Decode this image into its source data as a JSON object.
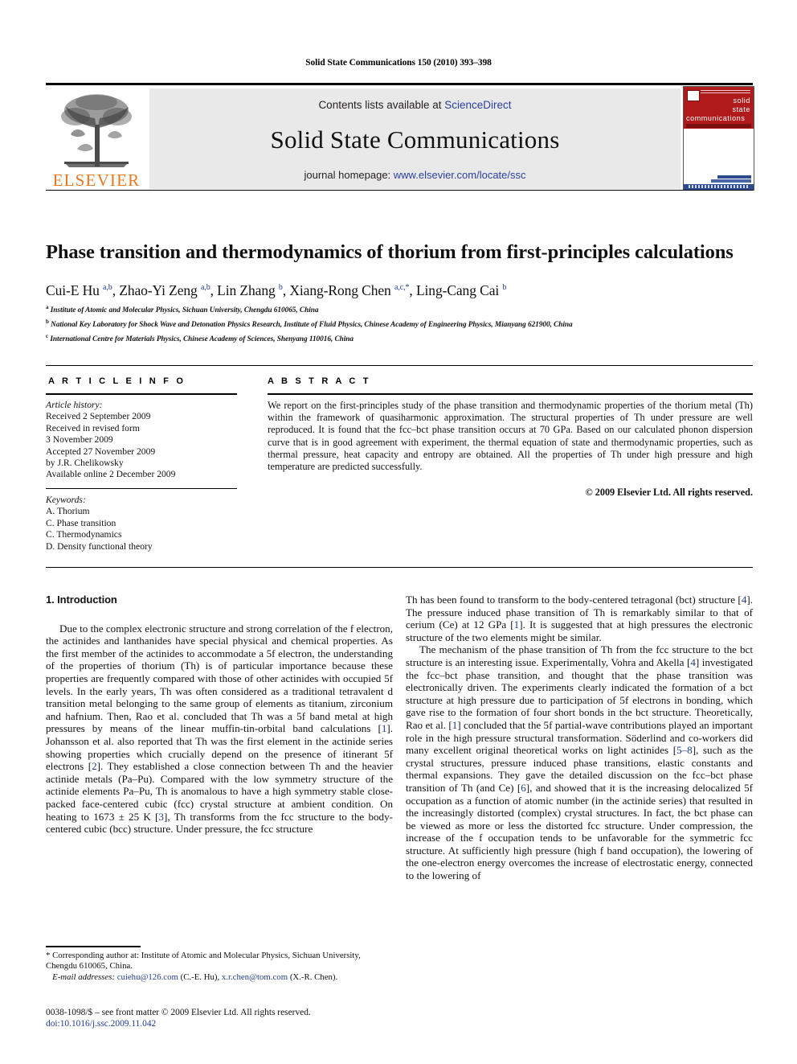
{
  "running_head": "Solid State Communications 150 (2010) 393–398",
  "masthead": {
    "contents_prefix": "Contents lists available at ",
    "sciencedirect": "ScienceDirect",
    "journal_title": "Solid State Communications",
    "homepage_prefix": "journal homepage: ",
    "homepage_url": "www.elsevier.com/locate/ssc",
    "publisher": "ELSEVIER",
    "cover": {
      "line1": "solid",
      "line2": "state",
      "line3": "communications"
    },
    "link_color": "#2b3f9e",
    "elsevier_orange": "#E87722",
    "band_gray": "#e9e9e9",
    "cover_red": "#b01a1a"
  },
  "article": {
    "title": "Phase transition and thermodynamics of thorium from first-principles calculations",
    "authors_html": "Cui-E Hu <sup>a,b</sup>, Zhao-Yi Zeng <sup>a,b</sup>, Lin Zhang <sup>b</sup>, Xiang-Rong Chen <sup>a,c,</sup><sup>*</sup>, Ling-Cang Cai <sup>b</sup>",
    "affiliations": [
      {
        "marker": "a",
        "text": "Institute of Atomic and Molecular Physics, Sichuan University, Chengdu 610065, China"
      },
      {
        "marker": "b",
        "text": "National Key Laboratory for Shock Wave and Detonation Physics Research, Institute of Fluid Physics, Chinese Academy of Engineering Physics, Mianyang 621900, China"
      },
      {
        "marker": "c",
        "text": "International Centre for Materials Physics, Chinese Academy of Sciences, Shenyang 110016, China"
      }
    ]
  },
  "info": {
    "heading": "A R T I C L E   I N F O",
    "history_label": "Article history:",
    "history_lines": [
      "Received 2 September 2009",
      "Received in revised form",
      "3 November 2009",
      "Accepted 27 November 2009",
      "by J.R. Chelikowsky",
      "Available online 2 December 2009"
    ],
    "keywords_label": "Keywords:",
    "keywords": [
      "A. Thorium",
      "C. Phase transition",
      "C. Thermodynamics",
      "D. Density functional theory"
    ]
  },
  "abstract": {
    "heading": "A B S T R A C T",
    "text": "We report on the first-principles study of the phase transition and thermodynamic properties of the thorium metal (Th) within the framework of quasiharmonic approximation. The structural properties of Th under pressure are well reproduced. It is found that the fcc–bct phase transition occurs at 70 GPa. Based on our calculated phonon dispersion curve that is in good agreement with experiment, the thermal equation of state and thermodynamic properties, such as thermal pressure, heat capacity and entropy are obtained. All the properties of Th under high pressure and high temperature are predicted successfully.",
    "copyright": "© 2009 Elsevier Ltd. All rights reserved."
  },
  "body": {
    "section_heading": "1. Introduction",
    "left_paragraphs": [
      "Due to the complex electronic structure and strong correlation of the f electron, the actinides and lanthanides have special physical and chemical properties. As the first member of the actinides to accommodate a 5f electron, the understanding of the properties of thorium (Th) is of particular importance because these properties are frequently compared with those of other actinides with occupied 5f levels. In the early years, Th was often considered as a traditional tetravalent d transition metal belonging to the same group of elements as titanium, zirconium and hafnium. Then, Rao et al. concluded that Th was a 5f band metal at high pressures by means of the linear muffin-tin-orbital band calculations [1]. Johansson et al. also reported that Th was the first element in the actinide series showing properties which crucially depend on the presence of itinerant 5f electrons [2]. They established a close connection between Th and the heavier actinide metals (Pa–Pu). Compared with the low symmetry structure of the actinide elements Pa–Pu, Th is anomalous to have a high symmetry stable close-packed face-centered cubic (fcc) crystal structure at ambient condition. On heating to 1673 ± 25 K [3], Th transforms from the fcc structure to the body-centered cubic (bcc) structure. Under pressure, the fcc structure"
    ],
    "right_paragraphs": [
      "Th has been found to transform to the body-centered tetragonal (bct) structure [4]. The pressure induced phase transition of Th is remarkably similar to that of cerium (Ce) at 12 GPa [1]. It is suggested that at high pressures the electronic structure of the two elements might be similar.",
      "The mechanism of the phase transition of Th from the fcc structure to the bct structure is an interesting issue. Experimentally, Vohra and Akella [4] investigated the fcc–bct phase transition, and thought that the phase transition was electronically driven. The experiments clearly indicated the formation of a bct structure at high pressure due to participation of 5f electrons in bonding, which gave rise to the formation of four short bonds in the bct structure. Theoretically, Rao et al. [1] concluded that the 5f partial-wave contributions played an important role in the high pressure structural transformation.  Söderlind and co-workers did many excellent original theoretical works on light actinides [5–8], such as the crystal structures, pressure induced phase transitions, elastic constants and thermal expansions. They gave the detailed discussion on the fcc–bct phase transition of Th (and Ce) [6], and showed that it is the increasing delocalized 5f occupation as a function of atomic number (in the actinide series) that resulted in the increasingly distorted (complex) crystal structures. In fact, the bct phase can be viewed as more or less the distorted fcc structure. Under compression, the increase of the f occupation tends to be unfavorable for the symmetric fcc structure. At sufficiently high pressure (high f band occupation), the lowering of the one-electron energy overcomes the increase of electrostatic energy, connected to the lowering of"
    ]
  },
  "footnote": {
    "corresponding": "* Corresponding author at: Institute of Atomic and Molecular Physics, Sichuan University, Chengdu 610065, China.",
    "email_label": "E-mail addresses:",
    "email1": "cuiehu@126.com",
    "email1_attrib": "(C.-E. Hu),",
    "email2": "x.r.chen@tom.com",
    "email2_attrib": "(X.-R. Chen)."
  },
  "imprint": {
    "line1": "0038-1098/$ – see front matter © 2009 Elsevier Ltd. All rights reserved.",
    "doi": "doi:10.1016/j.ssc.2009.11.042"
  }
}
